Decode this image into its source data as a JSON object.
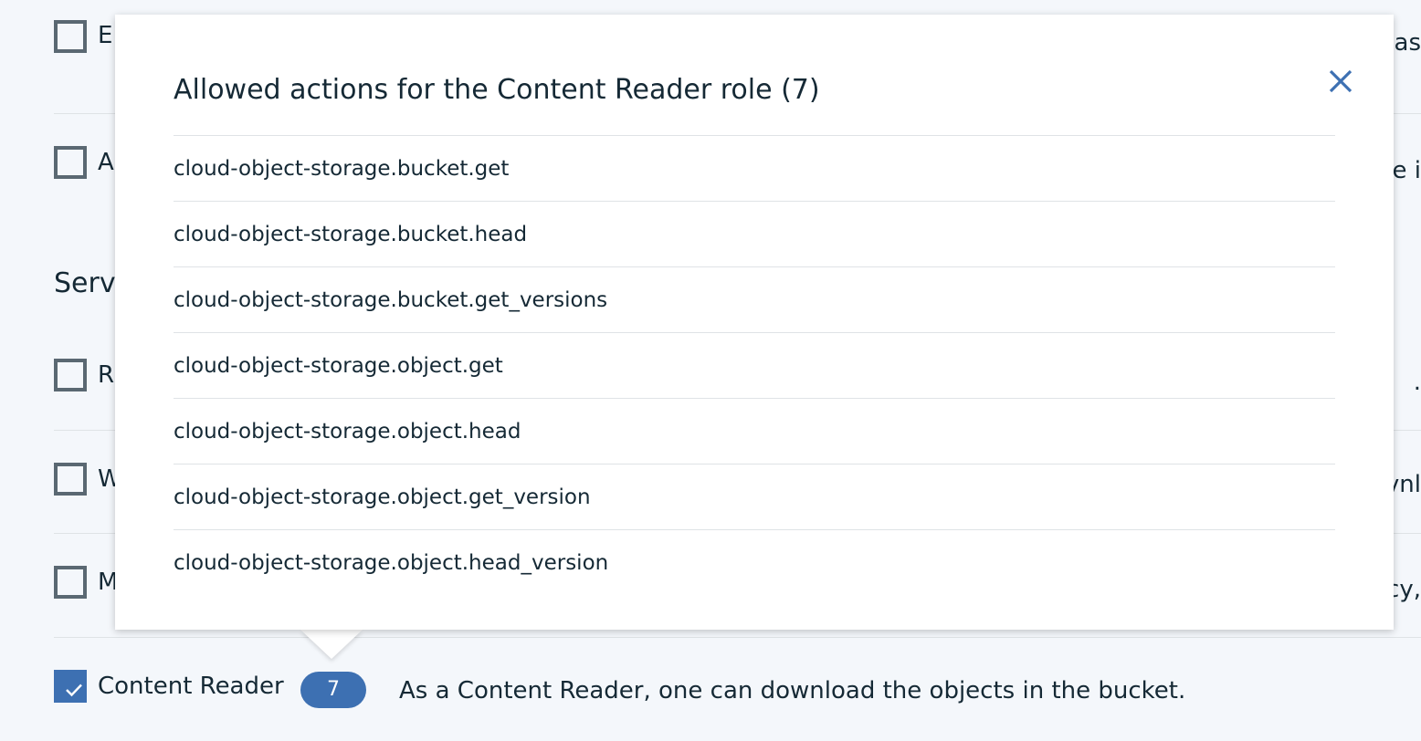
{
  "roles_section": {
    "title_fragment": "Serv",
    "rows": [
      {
        "label_fragment": "E",
        "right_fragment": "as",
        "checked": false
      },
      {
        "label_fragment": "A",
        "right_fragment": "e i",
        "checked": false
      },
      {
        "label_fragment": "R",
        "right_fragment": ".",
        "checked": false
      },
      {
        "label_fragment": "W",
        "right_fragment": "vnl",
        "checked": false
      },
      {
        "label_fragment": "M",
        "right_fragment": "cy,",
        "checked": false
      }
    ],
    "content_reader": {
      "label": "Content Reader",
      "checked": true,
      "badge_count": "7",
      "description": "As a Content Reader, one can download the objects in the bucket."
    }
  },
  "popover": {
    "title": "Allowed actions for the Content Reader role (7)",
    "close_icon": "close-icon",
    "actions": [
      "cloud-object-storage.bucket.get",
      "cloud-object-storage.bucket.head",
      "cloud-object-storage.bucket.get_versions",
      "cloud-object-storage.object.get",
      "cloud-object-storage.object.head",
      "cloud-object-storage.object.get_version",
      "cloud-object-storage.object.head_version"
    ]
  },
  "colors": {
    "accent": "#3d70b2",
    "text": "#152935",
    "background": "#f4f7fb",
    "divider": "#dfe3e6"
  }
}
